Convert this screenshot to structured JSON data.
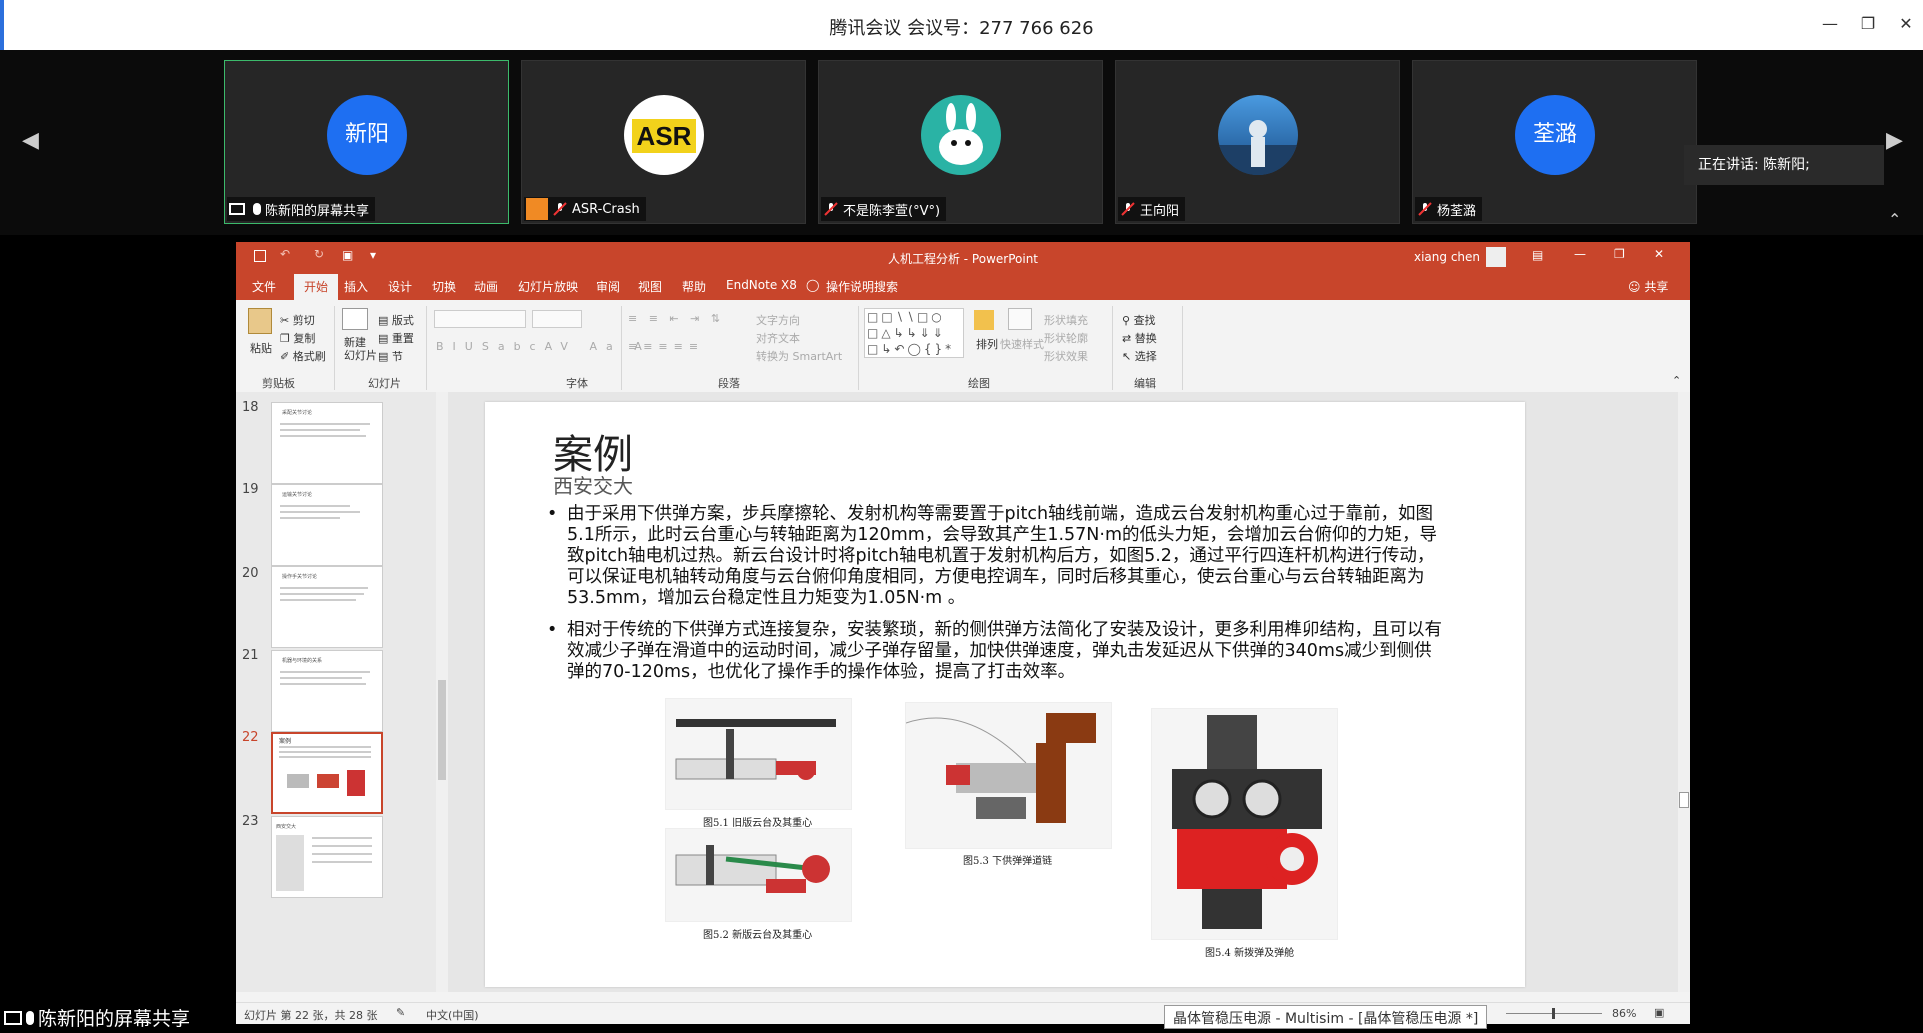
{
  "meeting": {
    "title": "腾讯会议 会议号：277 766 626",
    "speaking_prefix": "正在讲话: ",
    "speaking_name": "陈新阳;",
    "share_label": "陈新阳的屏幕共享",
    "participants": [
      {
        "avatar_text": "新阳",
        "label": "陈新阳的屏幕共享",
        "avatar_type": "text"
      },
      {
        "avatar_text": "",
        "label": "ASR-Crash",
        "avatar_type": "logo"
      },
      {
        "avatar_text": "",
        "label": "不是陈李萱(°V°)",
        "avatar_type": "cartoon"
      },
      {
        "avatar_text": "",
        "label": "王向阳",
        "avatar_type": "photo"
      },
      {
        "avatar_text": "荃潞",
        "label": "杨荃潞",
        "avatar_type": "text"
      }
    ],
    "colors": {
      "active_border": "#3cba6b",
      "avatar_blue": "#1e6ff2",
      "ppt_red": "#c8452b"
    }
  },
  "ppt": {
    "window_title": "人机工程分析  -  PowerPoint",
    "user": "xiang chen",
    "tabs": [
      "文件",
      "开始",
      "插入",
      "设计",
      "切换",
      "动画",
      "幻灯片放映",
      "审阅",
      "视图",
      "帮助",
      "EndNote X8",
      "操作说明搜索"
    ],
    "share": "共享",
    "ribbon": {
      "clipboard": {
        "paste": "粘贴",
        "cut": "剪切",
        "copy": "复制",
        "format_painter": "格式刷",
        "label": "剪贴板"
      },
      "slides": {
        "new_slide": "新建\n幻灯片",
        "layout": "版式",
        "reset": "重置",
        "section": "节",
        "label": "幻灯片"
      },
      "font": {
        "label": "字体"
      },
      "paragraph": {
        "text_direction": "文字方向",
        "align_text": "对齐文本",
        "smartart": "转换为 SmartArt",
        "label": "段落"
      },
      "drawing": {
        "arrange": "排列",
        "quick_styles": "快速样式",
        "shape_fill": "形状填充",
        "shape_outline": "形状轮廓",
        "shape_effects": "形状效果",
        "label": "绘图"
      },
      "editing": {
        "find": "查找",
        "replace": "替换",
        "select": "选择",
        "label": "编辑"
      }
    },
    "thumbnails": [
      {
        "num": "18",
        "title": "采配关节讨论"
      },
      {
        "num": "19",
        "title": "运输关节讨论"
      },
      {
        "num": "20",
        "title": "操作手关节讨论"
      },
      {
        "num": "21",
        "title": "机器与环境的关系"
      },
      {
        "num": "22",
        "title": "案例"
      },
      {
        "num": "23",
        "title": "西安交大"
      }
    ],
    "slide": {
      "title": "案例",
      "subtitle": "西安交大",
      "bullets": [
        "由于采用下供弹方案，步兵摩擦轮、发射机构等需要置于pitch轴线前端，造成云台发射机构重心过于靠前，如图5.1所示，此时云台重心与转轴距离为120mm，会导致其产生1.57N·m的低头力矩，会增加云台俯仰的力矩，导致pitch轴电机过热。新云台设计时将pitch轴电机置于发射机构后方，如图5.2，通过平行四连杆机构进行传动，可以保证电机轴转动角度与云台俯仰角度相同，方便电控调车，同时后移其重心，使云台重心与云台转轴距离为53.5mm，增加云台稳定性且力矩变为1.05N·m  。",
        "相对于传统的下供弹方式连接复杂，安装繁琐，新的侧供弹方法简化了安装及设计，更多利用榫卯结构，且可以有效减少子弹在滑道中的运动时间，减少子弹存留量，加快供弹速度，弹丸击发延迟从下供弹的340ms减少到侧供弹的70-120ms，也优化了操作手的操作体验，提高了打击效率。"
      ],
      "captions": [
        "图5.1  旧版云台及其重心",
        "图5.2  新版云台及其重心",
        "图5.3  下供弹弹道链",
        "图5.4  新拨弹及弹舱"
      ]
    },
    "status": {
      "slide_info": "幻灯片 第 22 张，共 28 张",
      "language": "中文(中国)",
      "zoom": "86%"
    }
  },
  "taskbar_hint": "晶体管稳压电源 - Multisim - [晶体管稳压电源 *]"
}
